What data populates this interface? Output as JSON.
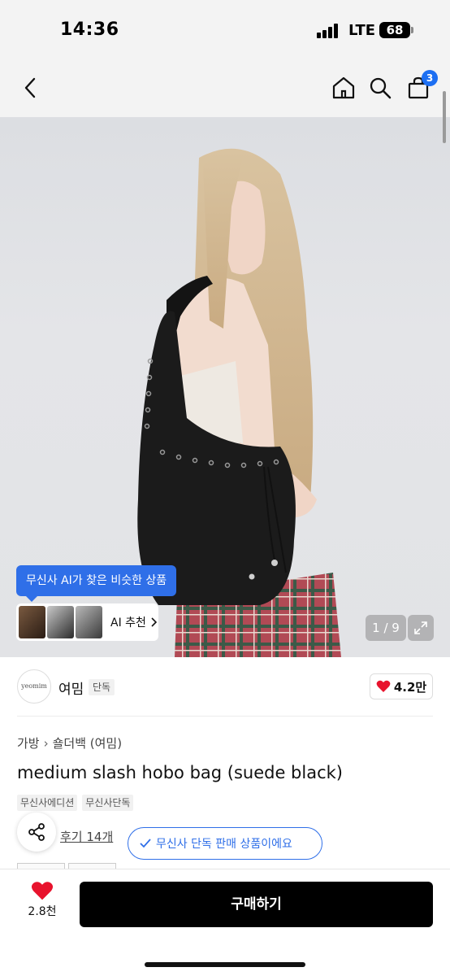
{
  "status_bar": {
    "time": "14:36",
    "network": "LTE",
    "battery": "68"
  },
  "nav": {
    "cart_badge": "3"
  },
  "gallery": {
    "ai_bubble": "무신사 AI가 찾은 비슷한 상품",
    "ai_button": "AI 추천",
    "counter": "1 / 9"
  },
  "brand": {
    "logo_text": "yeomim",
    "name": "여밈",
    "exclusive_tag": "단독",
    "like_count": "4.2만"
  },
  "product": {
    "breadcrumb": [
      "가방",
      "숄더백 (여밈)"
    ],
    "title": "medium slash hobo bag (suede black)",
    "tags": [
      "무신사에디션",
      "무신사단독"
    ],
    "review_link": "후기 14개",
    "notice": "무신사 단독 판매 상품이에요"
  },
  "bottom": {
    "wish_count": "2.8천",
    "buy_label": "구매하기"
  },
  "colors": {
    "accent": "#2f6fe8",
    "like": "#e8132d",
    "buy": "#000000"
  },
  "icons": [
    "back-icon",
    "home-icon",
    "search-icon",
    "cart-icon",
    "expand-icon",
    "heart-icon",
    "share-icon",
    "check-icon",
    "chevron-right-icon"
  ]
}
